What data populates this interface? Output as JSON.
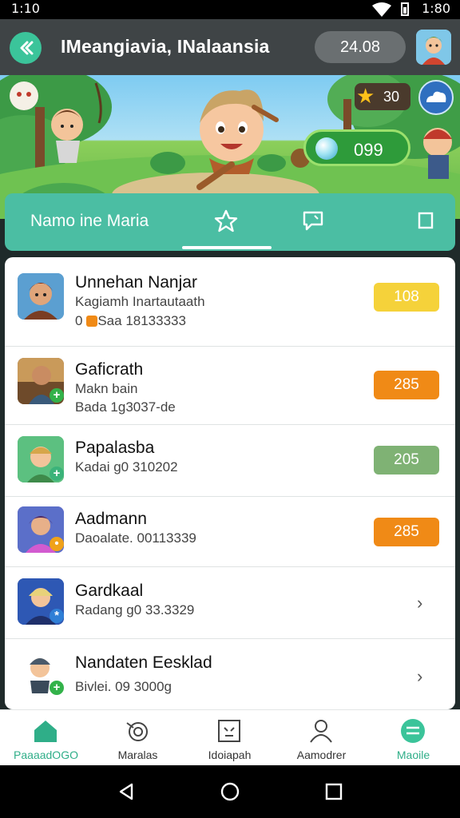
{
  "status_bar": {
    "time_left": "1:10",
    "time_right": "1:80"
  },
  "app_bar": {
    "title": "IMeangiavia, INalaansia",
    "score": "24.08"
  },
  "hero": {
    "star_count": "30",
    "gem_count": "099"
  },
  "tabs": {
    "label": "Namo ine Maria"
  },
  "list": [
    {
      "name": "Unnehan Nanjar",
      "line1": "Kagiamh Inartautaath",
      "line2": "0    Saa 18133333",
      "badge": "108",
      "badge_color": "#f5c518"
    },
    {
      "name": "Gaficrath",
      "line1": "Makn bain",
      "line2": "Bada 1g3037-de",
      "badge": "285",
      "badge_color": "#f08a16"
    },
    {
      "name": "Papalasba",
      "line1": "Kadai g0 310202",
      "badge": "205",
      "badge_color": "#7fb274"
    },
    {
      "name": "Aadmann",
      "line1": "Daoalate. 00113339",
      "badge": "285",
      "badge_color": "#f08a16"
    },
    {
      "name": "Gardkaal",
      "line1": "Radang g0 33.3329"
    },
    {
      "name": "Nandaten Eesklad",
      "line1": "Bivlei. 09 3000g"
    }
  ],
  "bottom_nav": [
    {
      "label": "PaaaadOGO",
      "active": true
    },
    {
      "label": "Maralas"
    },
    {
      "label": "Idoiapah"
    },
    {
      "label": "Aamodrer"
    },
    {
      "label": "Maoile"
    }
  ],
  "colors": {
    "accent": "#3bc49a",
    "app_bar": "#3f4446",
    "active_nav": "#2fae88"
  }
}
